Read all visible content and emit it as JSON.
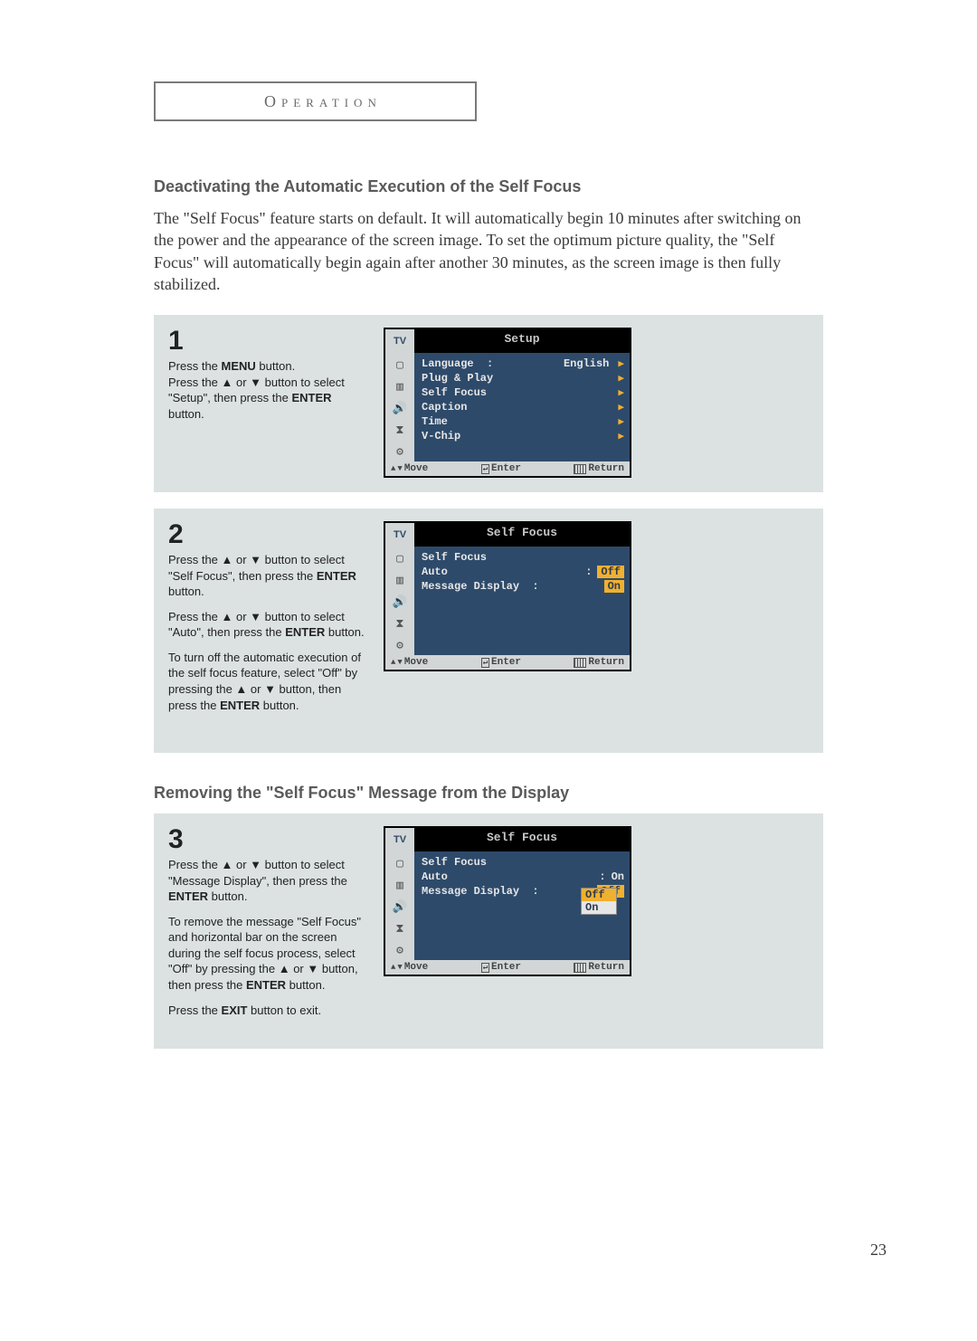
{
  "tab_label": "Operation",
  "section1_title": "Deactivating the Automatic Execution of the Self Focus",
  "intro": "The \"Self Focus\" feature starts on default. It will automatically begin 10 minutes after switching on the power and the appearance of the screen image. To set the optimum picture quality, the \"Self Focus\" will automatically begin again after another 30 minutes, as the screen image is then fully stabilized.",
  "step1": {
    "num": "1",
    "l1a": "Press the ",
    "l1b": "MENU",
    "l1c": " button.",
    "l2a": "Press the ▲ or ▼ button to select \"Setup\", then press the ",
    "l2b": "ENTER",
    "l2c": " button."
  },
  "osd1": {
    "title": "Setup",
    "rows": {
      "language_label": "Language  :",
      "language_value": "English",
      "plug": "Plug & Play",
      "self": "Self Focus",
      "caption": "Caption",
      "time": "Time",
      "vchip": "V-Chip"
    }
  },
  "step2": {
    "num": "2",
    "p1a": "Press the ▲ or ▼ button to select \"Self Focus\", then press the ",
    "p1b": "ENTER",
    "p1c": " button.",
    "p2a": "Press the ▲ or ▼ button to select \"Auto\", then press the ",
    "p2b": "ENTER",
    "p2c": " button.",
    "p3a": "To turn off the automatic execution of the self focus feature, select \"Off\" by pressing the ▲ or ▼ button, then press the ",
    "p3b": "ENTER",
    "p3c": " button."
  },
  "osd2": {
    "title": "Self Focus",
    "self": "Self Focus",
    "auto_label": "Auto",
    "auto_colon": ":",
    "auto_value": "Off",
    "msg_label": "Message Display  :",
    "msg_value": "On"
  },
  "section2_title": "Removing the \"Self Focus\" Message from the Display",
  "step3": {
    "num": "3",
    "p1a": "Press the ▲ or ▼ button to select \"Message Display\", then press the ",
    "p1b": "ENTER",
    "p1c": " button.",
    "p2a": "To remove the message \"Self Focus\" and horizontal bar on the screen during the self focus process, select \"Off\" by pressing the ▲ or ▼ button, then press the ",
    "p2b": "ENTER",
    "p2c": " button.",
    "p3a": "Press the ",
    "p3b": "EXIT",
    "p3c": " button to exit."
  },
  "osd3": {
    "title": "Self Focus",
    "self": "Self Focus",
    "auto_label": "Auto",
    "auto_value": "On",
    "msg_label": "Message Display  :",
    "msg_value": "Off",
    "dd_off": "Off",
    "dd_on": "On"
  },
  "footer": {
    "move": "Move",
    "enter": "Enter",
    "return": "Return"
  },
  "tv": "TV",
  "page_number": "23"
}
